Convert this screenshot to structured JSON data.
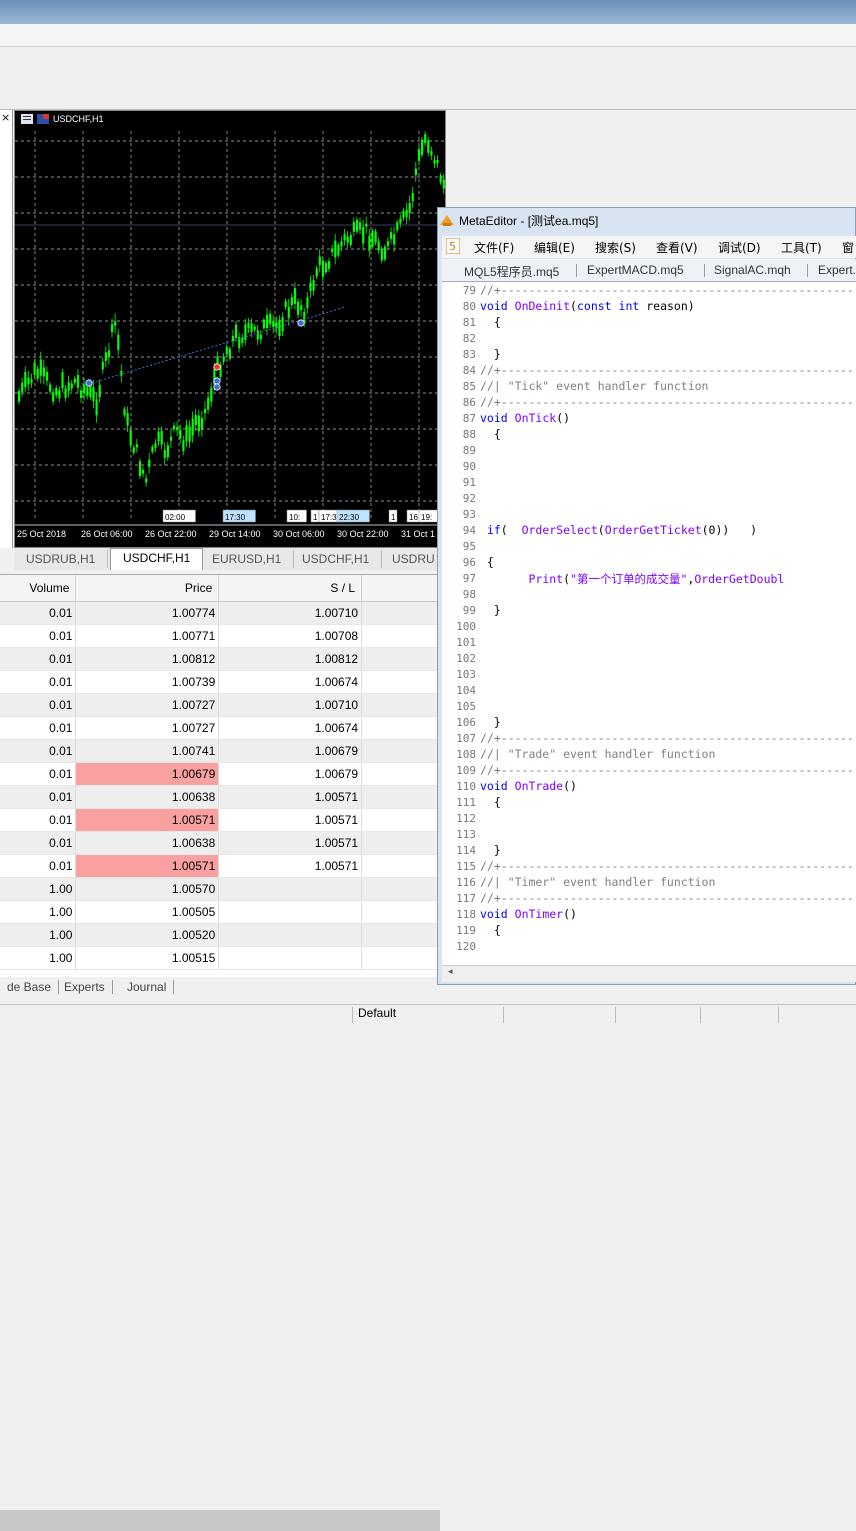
{
  "chart": {
    "symbol_title": "USDCHF,H1",
    "x_labels": [
      "25 Oct 2018",
      "26 Oct 06:00",
      "26 Oct 22:00",
      "29 Oct 14:00",
      "30 Oct 06:00",
      "30 Oct 22:00",
      "31 Oct 1"
    ],
    "time_markers": [
      "02:00",
      "17:30",
      "10:",
      "1",
      "17:3",
      "22:30",
      "1",
      "16",
      "19:"
    ],
    "colors": {
      "background": "#000000",
      "candles": "#00ff00",
      "grid": "#c0c0c0"
    }
  },
  "chart_tabs": [
    "USDRUB,H1",
    "USDCHF,H1",
    "EURUSD,H1",
    "USDCHF,H1",
    "USDRU"
  ],
  "orders": {
    "headers": [
      "Volume",
      "Price",
      "S / L"
    ],
    "rows": [
      [
        "0.01",
        "1.00774",
        "1.00710"
      ],
      [
        "0.01",
        "1.00771",
        "1.00708"
      ],
      [
        "0.01",
        "1.00812",
        "1.00812"
      ],
      [
        "0.01",
        "1.00739",
        "1.00674"
      ],
      [
        "0.01",
        "1.00727",
        "1.00710"
      ],
      [
        "0.01",
        "1.00727",
        "1.00674"
      ],
      [
        "0.01",
        "1.00741",
        "1.00679"
      ],
      [
        "0.01",
        "1.00679",
        "1.00679"
      ],
      [
        "0.01",
        "1.00638",
        "1.00571"
      ],
      [
        "0.01",
        "1.00571",
        "1.00571"
      ],
      [
        "0.01",
        "1.00638",
        "1.00571"
      ],
      [
        "0.01",
        "1.00571",
        "1.00571"
      ],
      [
        "1.00",
        "1.00570",
        ""
      ],
      [
        "1.00",
        "1.00505",
        ""
      ],
      [
        "1.00",
        "1.00520",
        ""
      ],
      [
        "1.00",
        "1.00515",
        ""
      ]
    ],
    "highlight_rows": [
      2,
      7,
      9,
      11
    ],
    "highlight_color": "#f9a0a0"
  },
  "bottom_tabs": [
    "de Base",
    "Experts",
    "Journal"
  ],
  "status": {
    "profile": "Default"
  },
  "metaeditor": {
    "title": "MetaEditor - [测试ea.mq5]",
    "menu": [
      "文件(F)",
      "编辑(E)",
      "搜索(S)",
      "查看(V)",
      "调试(D)",
      "工具(T)",
      "窗"
    ],
    "tabs": [
      "MQL5程序员.mq5",
      "ExpertMACD.mq5",
      "SignalAC.mqh",
      "Expert."
    ],
    "lines": [
      {
        "n": "79",
        "t": "//+------------------------------------------------------------------"
      },
      {
        "n": "80",
        "t": "void OnDeinit(const int reason)"
      },
      {
        "n": "81",
        "t": "  {"
      },
      {
        "n": "82",
        "t": ""
      },
      {
        "n": "83",
        "t": "  }"
      },
      {
        "n": "84",
        "t": "//+------------------------------------------------------------------"
      },
      {
        "n": "85",
        "t": "//| \"Tick\" event handler function"
      },
      {
        "n": "86",
        "t": "//+------------------------------------------------------------------"
      },
      {
        "n": "87",
        "t": "void OnTick()"
      },
      {
        "n": "88",
        "t": "  {"
      },
      {
        "n": "89",
        "t": ""
      },
      {
        "n": "90",
        "t": ""
      },
      {
        "n": "91",
        "t": ""
      },
      {
        "n": "92",
        "t": ""
      },
      {
        "n": "93",
        "t": ""
      },
      {
        "n": "94",
        "t": " if(  OrderSelect(OrderGetTicket(0))   )"
      },
      {
        "n": "95",
        "t": ""
      },
      {
        "n": "96",
        "t": " {"
      },
      {
        "n": "97",
        "t": "       Print(\"第一个订单的成交量\",OrderGetDoubl"
      },
      {
        "n": "98",
        "t": ""
      },
      {
        "n": "99",
        "t": "  }"
      },
      {
        "n": "100",
        "t": ""
      },
      {
        "n": "101",
        "t": ""
      },
      {
        "n": "102",
        "t": ""
      },
      {
        "n": "103",
        "t": ""
      },
      {
        "n": "104",
        "t": ""
      },
      {
        "n": "105",
        "t": ""
      },
      {
        "n": "106",
        "t": "  }"
      },
      {
        "n": "107",
        "t": "//+------------------------------------------------------------------"
      },
      {
        "n": "108",
        "t": "//| \"Trade\" event handler function"
      },
      {
        "n": "109",
        "t": "//+------------------------------------------------------------------"
      },
      {
        "n": "110",
        "t": "void OnTrade()"
      },
      {
        "n": "111",
        "t": "  {"
      },
      {
        "n": "112",
        "t": ""
      },
      {
        "n": "113",
        "t": ""
      },
      {
        "n": "114",
        "t": "  }"
      },
      {
        "n": "115",
        "t": "//+------------------------------------------------------------------"
      },
      {
        "n": "116",
        "t": "//| \"Timer\" event handler function"
      },
      {
        "n": "117",
        "t": "//+------------------------------------------------------------------"
      },
      {
        "n": "118",
        "t": "void OnTimer()"
      },
      {
        "n": "119",
        "t": "  {"
      },
      {
        "n": "120",
        "t": ""
      }
    ]
  }
}
